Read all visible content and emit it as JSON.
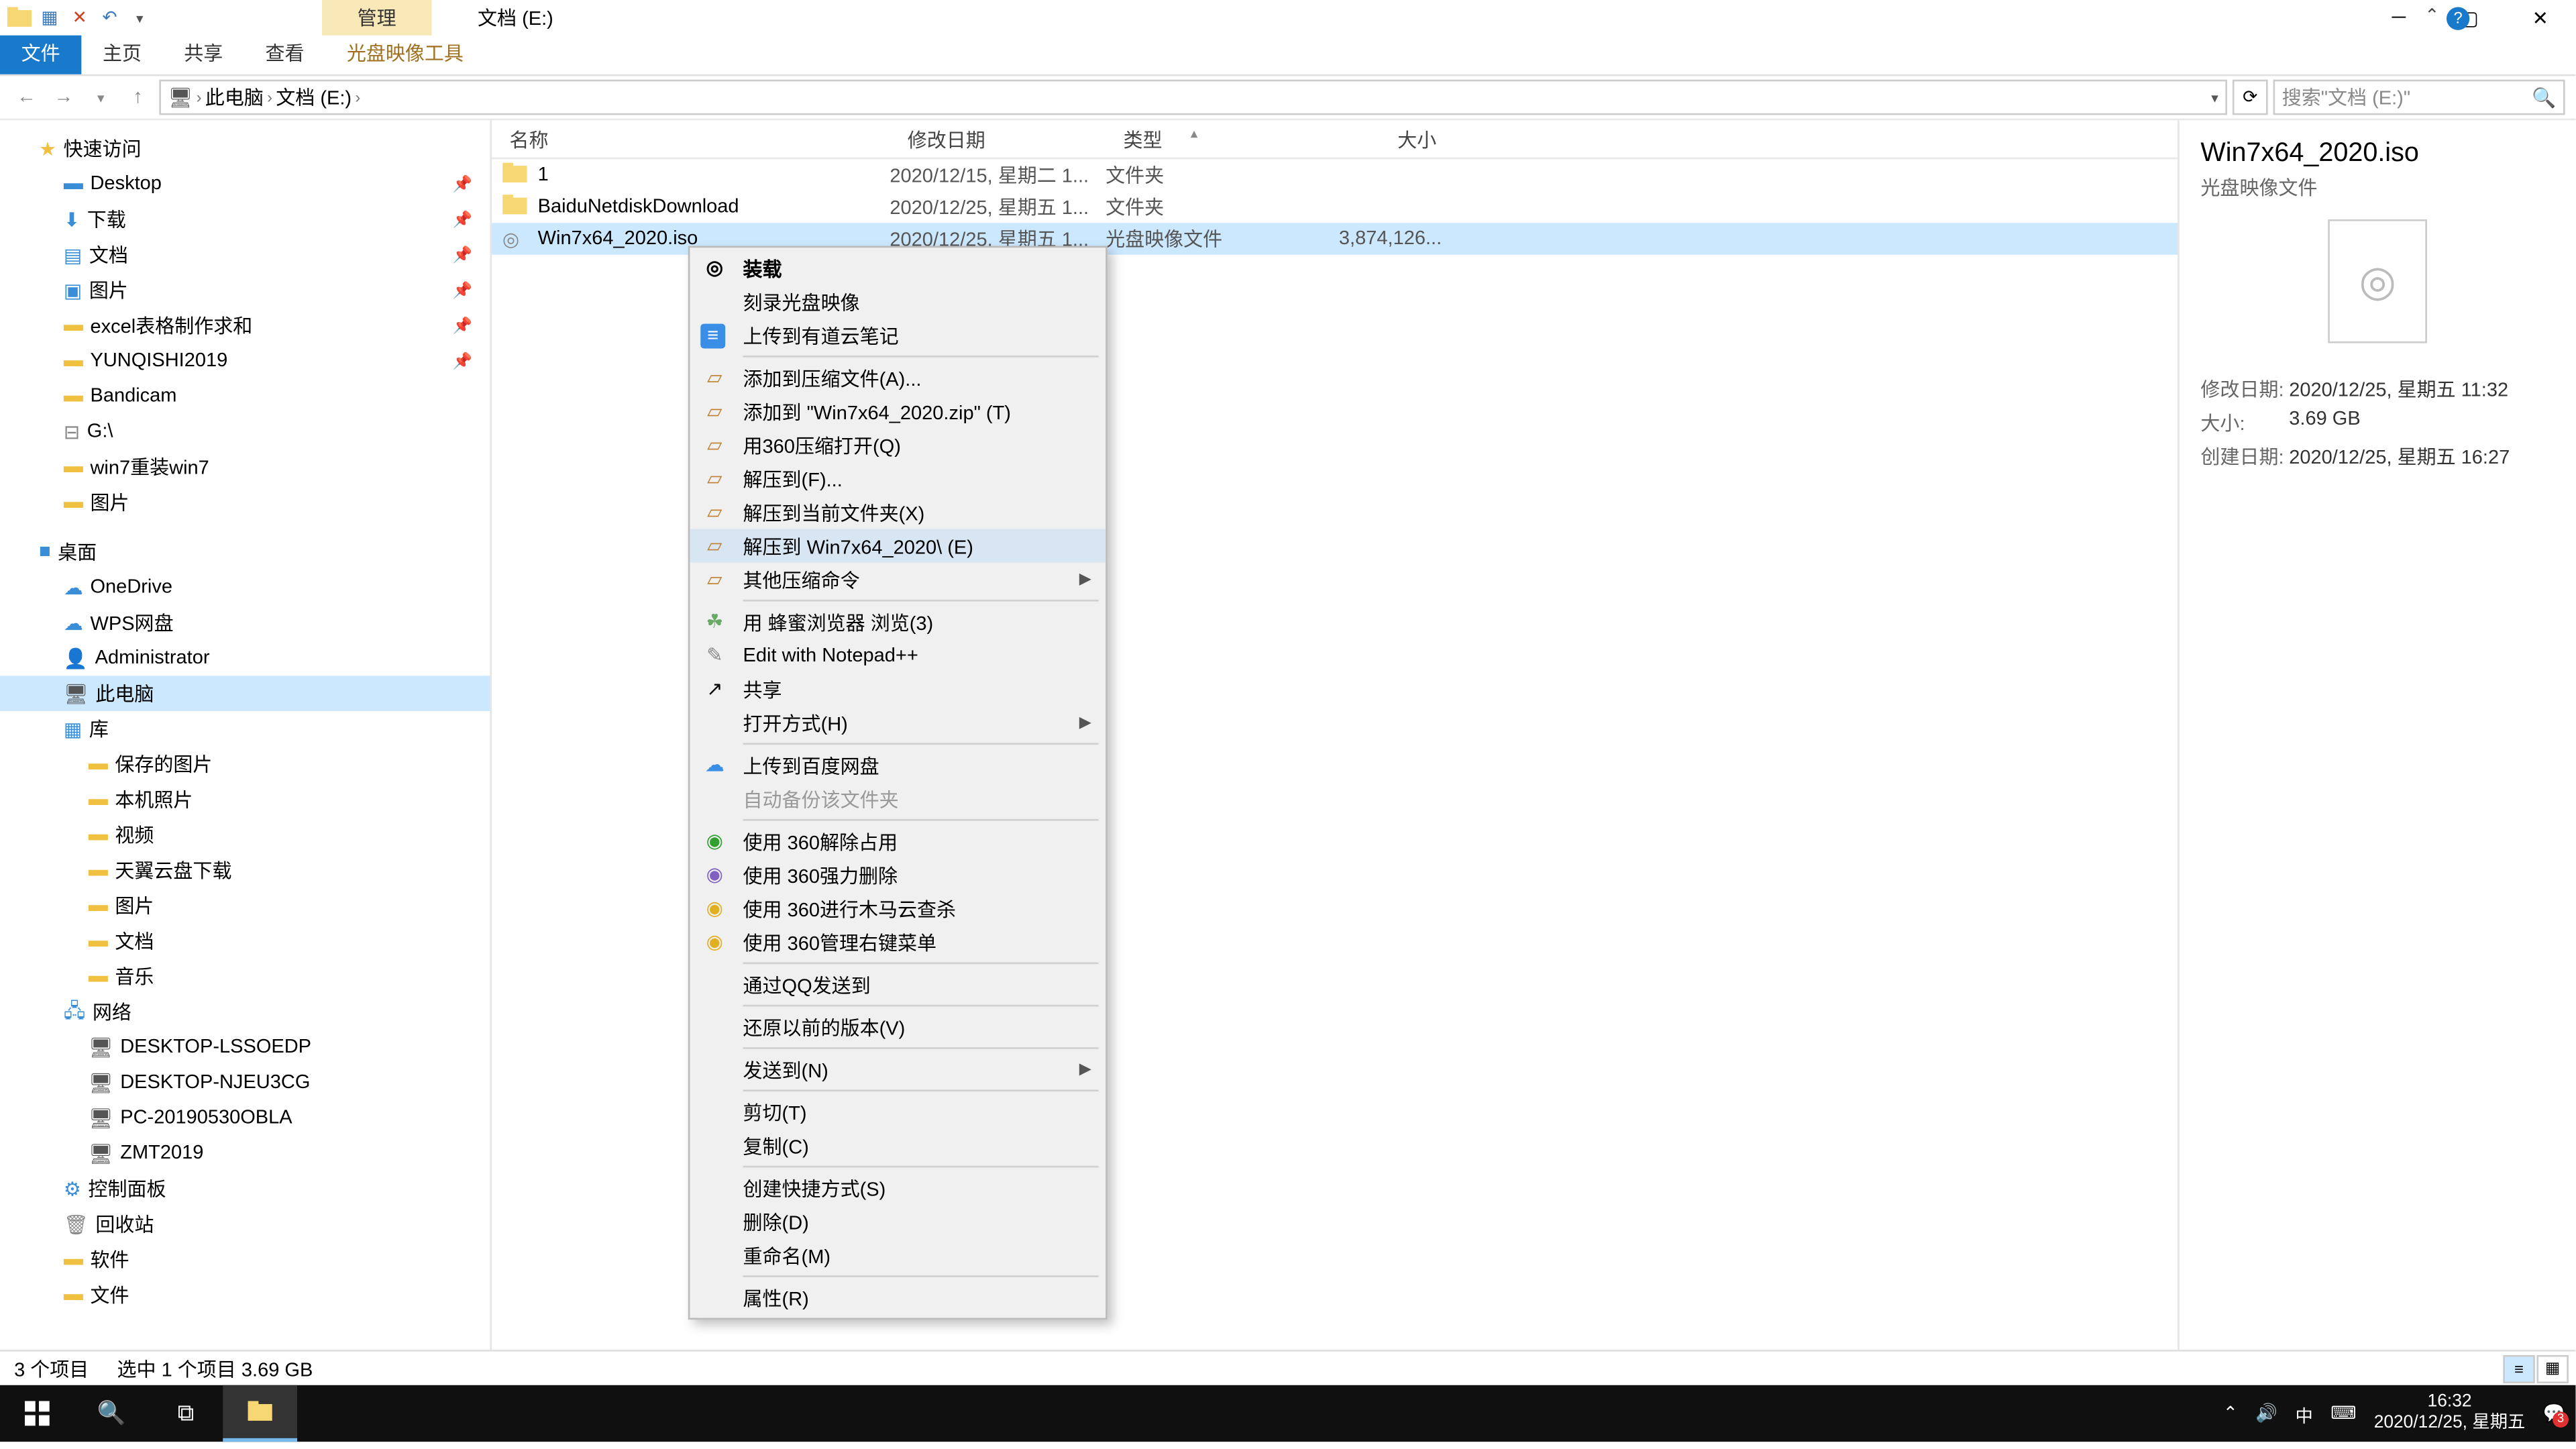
{
  "window": {
    "ribbon_context": "管理",
    "title": "文档 (E:)"
  },
  "ribbon_tabs": {
    "file": "文件",
    "home": "主页",
    "share": "共享",
    "view": "查看",
    "iso_tools": "光盘映像工具"
  },
  "address": {
    "root": "此电脑",
    "folder": "文档 (E:)"
  },
  "search": {
    "placeholder": "搜索\"文档 (E:)\""
  },
  "tree": {
    "quick_access": "快速访问",
    "desktop": "Desktop",
    "downloads": "下载",
    "documents": "文档",
    "pictures": "图片",
    "excel": "excel表格制作求和",
    "yunqishi": "YUNQISHI2019",
    "bandicam": "Bandicam",
    "gdrive": "G:\\",
    "win7reinstall": "win7重装win7",
    "pictures2": "图片",
    "desktop_cn": "桌面",
    "onedrive": "OneDrive",
    "wps": "WPS网盘",
    "admin": "Administrator",
    "thispc": "此电脑",
    "library": "库",
    "saved_pics": "保存的图片",
    "camera_roll": "本机照片",
    "videos": "视频",
    "tianyi": "天翼云盘下载",
    "pictures3": "图片",
    "documents2": "文档",
    "music": "音乐",
    "network": "网络",
    "pc1": "DESKTOP-LSSOEDP",
    "pc2": "DESKTOP-NJEU3CG",
    "pc3": "PC-20190530OBLA",
    "pc4": "ZMT2019",
    "control_panel": "控制面板",
    "recycle": "回收站",
    "software": "软件",
    "files_folder": "文件"
  },
  "columns": {
    "name": "名称",
    "date": "修改日期",
    "type": "类型",
    "size": "大小"
  },
  "rows": [
    {
      "icon": "folder",
      "name": "1",
      "date": "2020/12/15, 星期二 1...",
      "type": "文件夹",
      "size": ""
    },
    {
      "icon": "folder",
      "name": "BaiduNetdiskDownload",
      "date": "2020/12/25, 星期五 1...",
      "type": "文件夹",
      "size": ""
    },
    {
      "icon": "iso",
      "name": "Win7x64_2020.iso",
      "date": "2020/12/25, 星期五 1...",
      "type": "光盘映像文件",
      "size": "3,874,126..."
    }
  ],
  "context_menu": {
    "mount": "装载",
    "burn": "刻录光盘映像",
    "youdao": "上传到有道云笔记",
    "add_archive": "添加到压缩文件(A)...",
    "add_zip": "添加到 \"Win7x64_2020.zip\" (T)",
    "open_360zip": "用360压缩打开(Q)",
    "extract_to": "解压到(F)...",
    "extract_here": "解压到当前文件夹(X)",
    "extract_named": "解压到 Win7x64_2020\\ (E)",
    "other_zip": "其他压缩命令",
    "honey_browser": "用 蜂蜜浏览器 浏览(3)",
    "notepadpp": "Edit with Notepad++",
    "share": "共享",
    "open_with": "打开方式(H)",
    "baidu_upload": "上传到百度网盘",
    "auto_backup": "自动备份该文件夹",
    "use_360_unlock": "使用 360解除占用",
    "use_360_force_del": "使用 360强力删除",
    "use_360_trojan": "使用 360进行木马云查杀",
    "use_360_menu": "使用 360管理右键菜单",
    "qq_send": "通过QQ发送到",
    "restore_prev": "还原以前的版本(V)",
    "send_to": "发送到(N)",
    "cut": "剪切(T)",
    "copy": "复制(C)",
    "shortcut": "创建快捷方式(S)",
    "delete": "删除(D)",
    "rename": "重命名(M)",
    "properties": "属性(R)"
  },
  "preview": {
    "title": "Win7x64_2020.iso",
    "type": "光盘映像文件",
    "mod_label": "修改日期:",
    "mod_val": "2020/12/25, 星期五 11:32",
    "size_label": "大小:",
    "size_val": "3.69 GB",
    "created_label": "创建日期:",
    "created_val": "2020/12/25, 星期五 16:27"
  },
  "status": {
    "count": "3 个项目",
    "selection": "选中 1 个项目  3.69 GB"
  },
  "taskbar": {
    "time": "16:32",
    "date": "2020/12/25, 星期五",
    "ime": "中",
    "badge": "3"
  }
}
